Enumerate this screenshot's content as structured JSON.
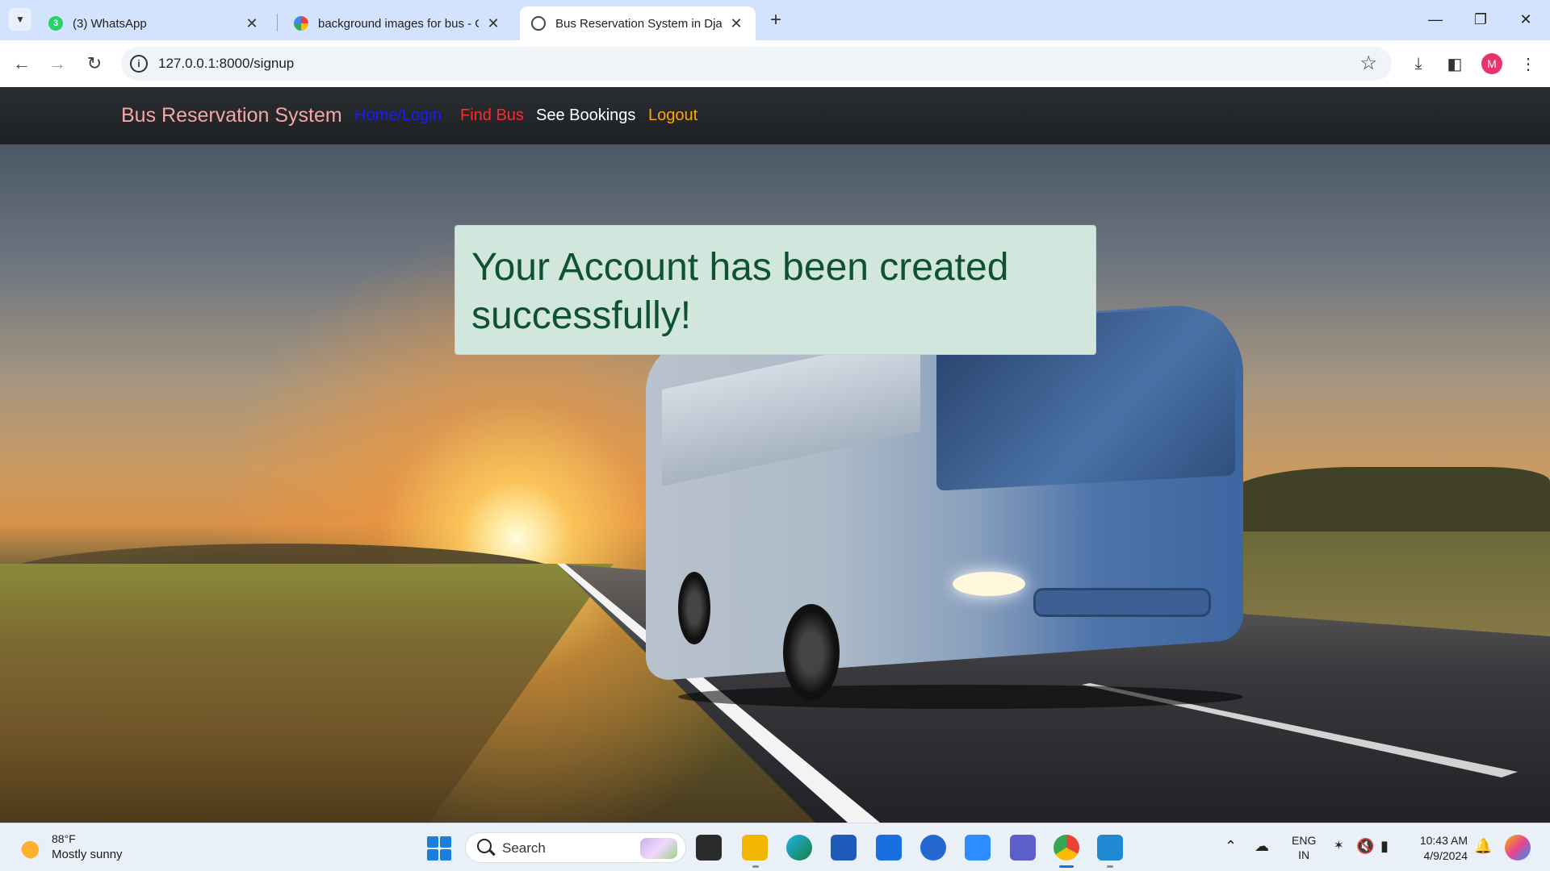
{
  "browser": {
    "tabs": [
      {
        "title": "(3) WhatsApp",
        "icon": "whatsapp-icon",
        "active": false
      },
      {
        "title": "background images for bus - G",
        "icon": "google-icon",
        "active": false
      },
      {
        "title": "Bus Reservation System in Djan",
        "icon": "globe-icon",
        "active": true
      }
    ],
    "url": "127.0.0.1:8000/signup",
    "profile_initial": "M"
  },
  "site": {
    "brand": "Bus Reservation System",
    "nav": {
      "home_login": "Home/Login",
      "find_bus": "Find Bus",
      "see_bookings": "See Bookings",
      "logout": "Logout"
    },
    "colors": {
      "brand": "#f2a7a7",
      "home_login": "#1a1aff",
      "find_bus": "#ff2a2a",
      "see_bookings": "#ffffff",
      "logout": "#ffa500"
    },
    "alert": {
      "message": "Your Account has been created successfully!",
      "type": "success",
      "bg_color": "#d1e7dd",
      "text_color": "#0f5132"
    }
  },
  "taskbar": {
    "weather": {
      "temp": "88°F",
      "desc": "Mostly sunny"
    },
    "search_label": "Search",
    "apps": [
      "task-view-icon",
      "file-explorer-icon",
      "edge-icon",
      "store-icon",
      "widgets-icon",
      "sync-icon",
      "zoom-icon",
      "teams-icon",
      "chrome-icon",
      "vscode-icon"
    ],
    "lang": {
      "line1": "ENG",
      "line2": "IN"
    },
    "clock": {
      "time": "10:43 AM",
      "date": "4/9/2024"
    }
  }
}
